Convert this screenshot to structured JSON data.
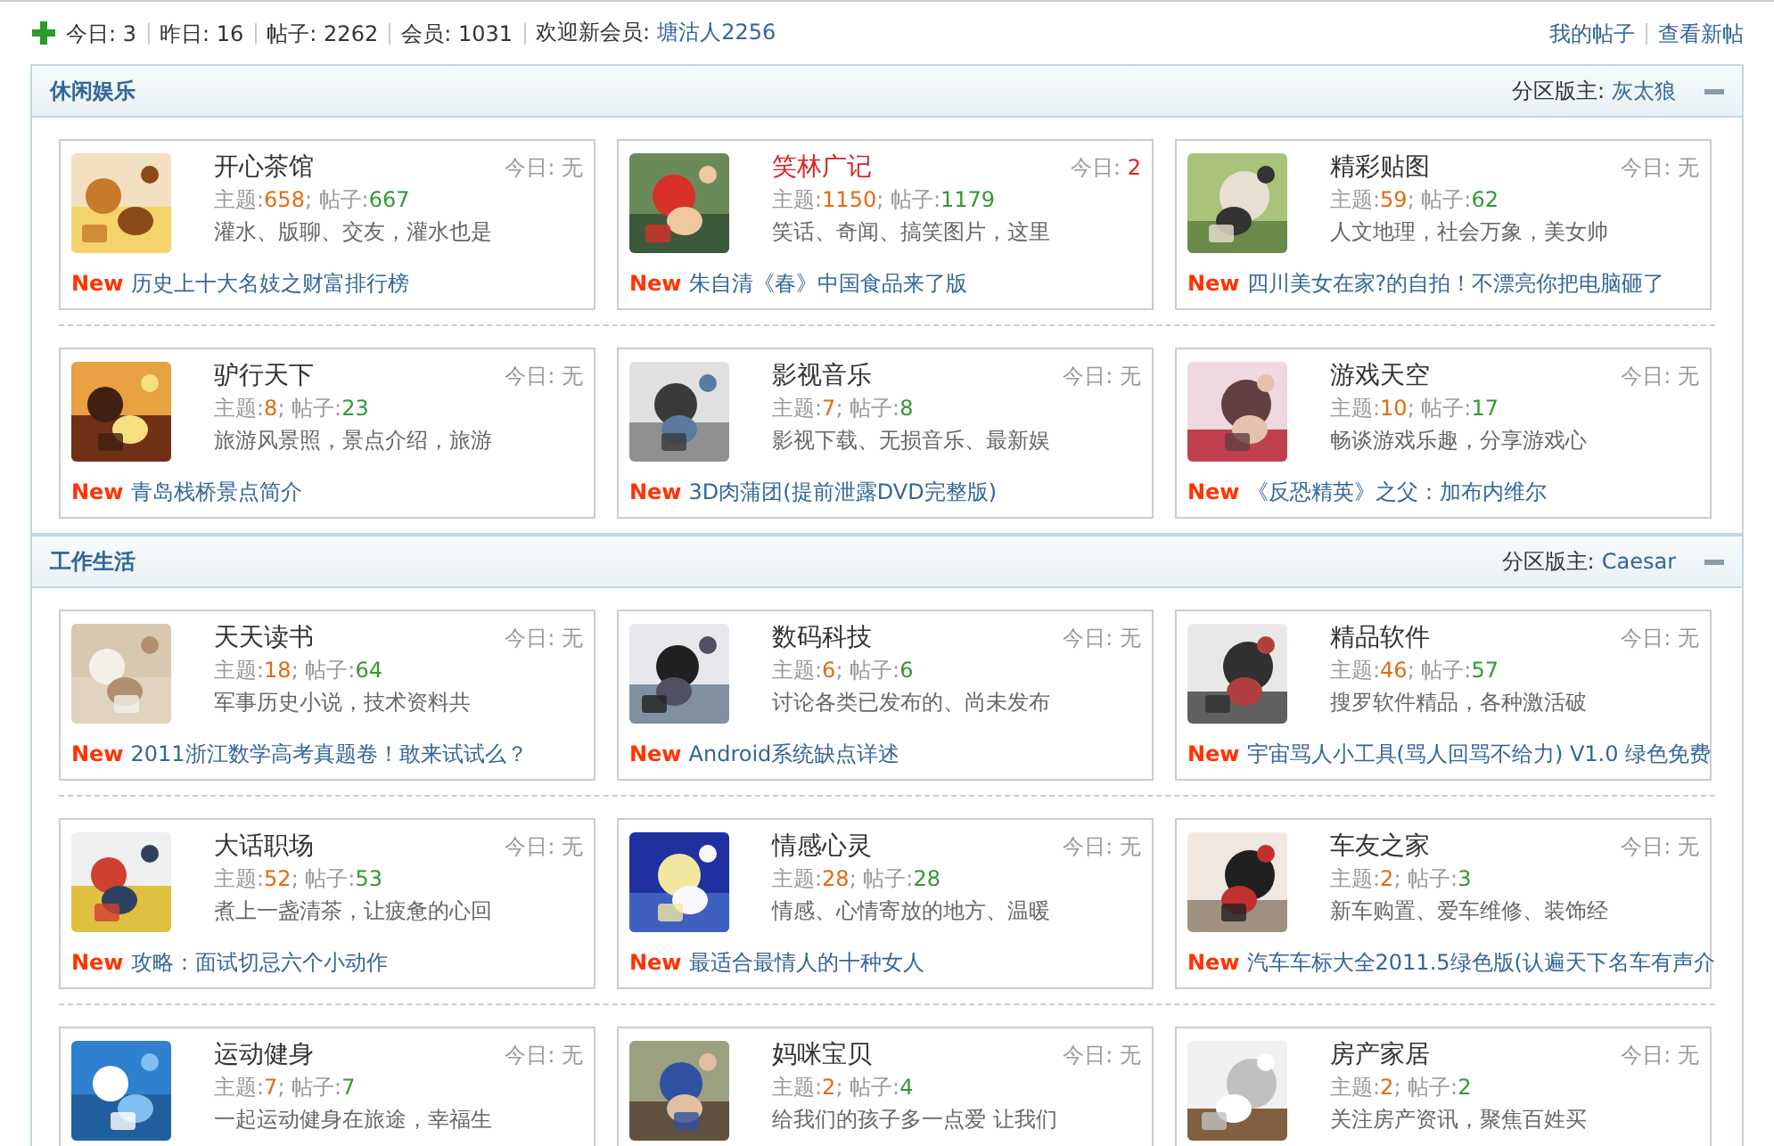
{
  "stats_bar": {
    "items": [
      {
        "label": "今日:",
        "value": "3"
      },
      {
        "label": "昨日:",
        "value": "16"
      },
      {
        "label": "帖子:",
        "value": "2262"
      },
      {
        "label": "会员:",
        "value": "1031"
      }
    ],
    "welcome": {
      "label": "欢迎新会员:",
      "member": "塘沽人2256"
    },
    "links": [
      "我的帖子",
      "查看新帖"
    ]
  },
  "sections": [
    {
      "title": "休闲娱乐",
      "moderator_label": "分区版主:",
      "moderator": "灰太狼",
      "expanded": true,
      "rows": [
        [
          {
            "name": "开心茶馆",
            "hot": false,
            "today_label": "今日:",
            "today": "无",
            "topics_label": "主题:",
            "topics": "658",
            "posts_label": "; 帖子:",
            "posts": "667",
            "description": "灌水、版聊、交友，灌水也是",
            "new_label": "New",
            "latest": "历史上十大名妓之财富排行榜"
          },
          {
            "name": "笑林广记",
            "hot": true,
            "today_label": "今日:",
            "today": "2",
            "topics_label": "主题:",
            "topics": "1150",
            "posts_label": "; 帖子:",
            "posts": "1179",
            "description": "笑话、奇闻、搞笑图片，这里",
            "new_label": "New",
            "latest": "朱自清《春》中国食品来了版"
          },
          {
            "name": "精彩贴图",
            "hot": false,
            "today_label": "今日:",
            "today": "无",
            "topics_label": "主题:",
            "topics": "59",
            "posts_label": "; 帖子:",
            "posts": "62",
            "description": "人文地理，社会万象，美女帅",
            "new_label": "New",
            "latest": "四川美女在家?的自拍！不漂亮你把电脑砸了"
          }
        ],
        [
          {
            "name": "驴行天下",
            "hot": false,
            "today_label": "今日:",
            "today": "无",
            "topics_label": "主题:",
            "topics": "8",
            "posts_label": "; 帖子:",
            "posts": "23",
            "description": "旅游风景照，景点介绍，旅游",
            "new_label": "New",
            "latest": "青岛栈桥景点简介"
          },
          {
            "name": "影视音乐",
            "hot": false,
            "today_label": "今日:",
            "today": "无",
            "topics_label": "主题:",
            "topics": "7",
            "posts_label": "; 帖子:",
            "posts": "8",
            "description": "影视下载、无损音乐、最新娱",
            "new_label": "New",
            "latest": "3D肉蒲团(提前泄露DVD完整版)"
          },
          {
            "name": "游戏天空",
            "hot": false,
            "today_label": "今日:",
            "today": "无",
            "topics_label": "主题:",
            "topics": "10",
            "posts_label": "; 帖子:",
            "posts": "17",
            "description": "畅谈游戏乐趣，分享游戏心",
            "new_label": "New",
            "latest": "《反恐精英》之父：加布内维尔"
          }
        ]
      ]
    },
    {
      "title": "工作生活",
      "moderator_label": "分区版主:",
      "moderator": "Caesar",
      "expanded": true,
      "rows": [
        [
          {
            "name": "天天读书",
            "hot": false,
            "today_label": "今日:",
            "today": "无",
            "topics_label": "主题:",
            "topics": "18",
            "posts_label": "; 帖子:",
            "posts": "64",
            "description": "军事历史小说，技术资料共",
            "new_label": "New",
            "latest": "2011浙江数学高考真题卷！敢来试试么？"
          },
          {
            "name": "数码科技",
            "hot": false,
            "today_label": "今日:",
            "today": "无",
            "topics_label": "主题:",
            "topics": "6",
            "posts_label": "; 帖子:",
            "posts": "6",
            "description": "讨论各类已发布的、尚未发布",
            "new_label": "New",
            "latest": "Android系统缺点详述"
          },
          {
            "name": "精品软件",
            "hot": false,
            "today_label": "今日:",
            "today": "无",
            "topics_label": "主题:",
            "topics": "46",
            "posts_label": "; 帖子:",
            "posts": "57",
            "description": "搜罗软件精品，各种激活破",
            "new_label": "New",
            "latest": "宇宙骂人小工具(骂人回骂不给力) V1.0 绿色免费"
          }
        ],
        [
          {
            "name": "大话职场",
            "hot": false,
            "today_label": "今日:",
            "today": "无",
            "topics_label": "主题:",
            "topics": "52",
            "posts_label": "; 帖子:",
            "posts": "53",
            "description": "煮上一盏清茶，让疲惫的心回",
            "new_label": "New",
            "latest": "攻略：面试切忌六个小动作"
          },
          {
            "name": "情感心灵",
            "hot": false,
            "today_label": "今日:",
            "today": "无",
            "topics_label": "主题:",
            "topics": "28",
            "posts_label": "; 帖子:",
            "posts": "28",
            "description": "情感、心情寄放的地方、温暖",
            "new_label": "New",
            "latest": "最适合最情人的十种女人"
          },
          {
            "name": "车友之家",
            "hot": false,
            "today_label": "今日:",
            "today": "无",
            "topics_label": "主题:",
            "topics": "2",
            "posts_label": "; 帖子:",
            "posts": "3",
            "description": "新车购置、爱车维修、装饰经",
            "new_label": "New",
            "latest": "汽车车标大全2011.5绿色版(认遍天下名车有声介"
          }
        ],
        [
          {
            "name": "运动健身",
            "hot": false,
            "today_label": "今日:",
            "today": "无",
            "topics_label": "主题:",
            "topics": "7",
            "posts_label": "; 帖子:",
            "posts": "7",
            "description": "一起运动健身在旅途，幸福生"
          },
          {
            "name": "妈咪宝贝",
            "hot": false,
            "today_label": "今日:",
            "today": "无",
            "topics_label": "主题:",
            "topics": "2",
            "posts_label": "; 帖子:",
            "posts": "4",
            "description": "给我们的孩子多一点爱 让我们"
          },
          {
            "name": "房产家居",
            "hot": false,
            "today_label": "今日:",
            "today": "无",
            "topics_label": "主题:",
            "topics": "2",
            "posts_label": "; 帖子:",
            "posts": "2",
            "description": "关注房产资讯，聚焦百姓买"
          }
        ]
      ]
    }
  ]
}
